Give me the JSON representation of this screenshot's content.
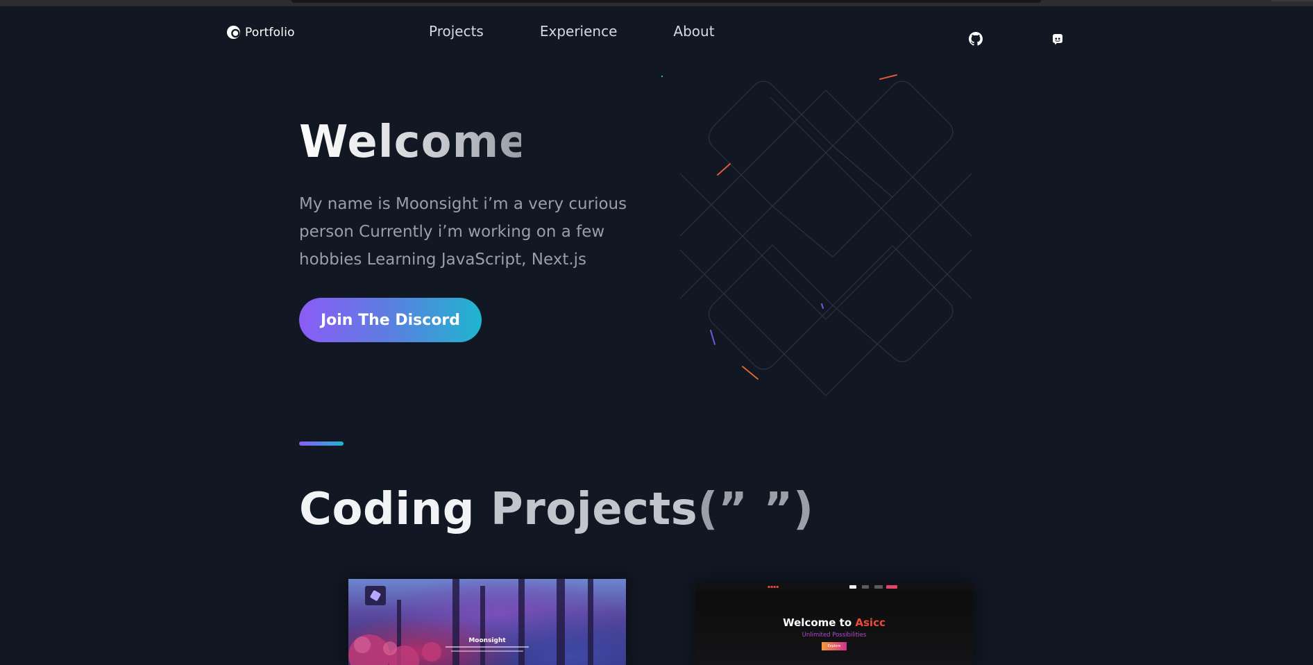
{
  "nav": {
    "brand": "Portfolio",
    "links": [
      {
        "label": "Projects"
      },
      {
        "label": "Experience"
      },
      {
        "label": "About"
      }
    ],
    "icons": [
      "github-icon",
      "discord-icon"
    ]
  },
  "hero": {
    "title": "Welcome",
    "description": "My name is Moonsight i’m a very curious person Currently i’m working on a few hobbies Learning JavaScript, Next.js",
    "cta_label": "Join The Discord"
  },
  "section": {
    "title_part1": "Coding",
    "title_part2": "Projects",
    "title_part3": "(” ”)"
  },
  "projects": [
    {
      "title": "Moonsight"
    },
    {
      "title_prefix": "Welcome to",
      "title_accent": "Asicc",
      "subtitle": "Unlimited Possibilities",
      "button": "Explore"
    }
  ],
  "colors": {
    "background": "#111723",
    "accent_start": "#8b5cf6",
    "accent_end": "#1fb5cf"
  }
}
